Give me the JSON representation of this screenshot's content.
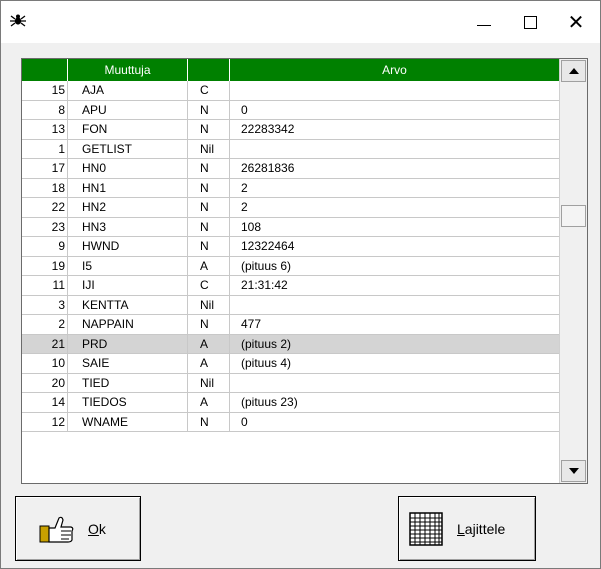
{
  "window": {
    "app_icon": "spider-icon",
    "controls": {
      "minimize": "minimize-icon",
      "maximize": "maximize-icon",
      "close": "close-icon"
    }
  },
  "grid": {
    "columns": [
      "",
      "Muuttuja",
      "",
      "Arvo"
    ],
    "header_color": "#008000",
    "selected_row_color": "#d4d4d4",
    "rows": [
      {
        "num": "15",
        "name": "AJA",
        "type": "C",
        "value": ""
      },
      {
        "num": "8",
        "name": "APU",
        "type": "N",
        "value": "0"
      },
      {
        "num": "13",
        "name": "FON",
        "type": "N",
        "value": "22283342"
      },
      {
        "num": "1",
        "name": "GETLIST",
        "type": "Nil",
        "value": ""
      },
      {
        "num": "17",
        "name": "HN0",
        "type": "N",
        "value": "26281836"
      },
      {
        "num": "18",
        "name": "HN1",
        "type": "N",
        "value": "2"
      },
      {
        "num": "22",
        "name": "HN2",
        "type": "N",
        "value": "2"
      },
      {
        "num": "23",
        "name": "HN3",
        "type": "N",
        "value": "108"
      },
      {
        "num": "9",
        "name": "HWND",
        "type": "N",
        "value": "12322464"
      },
      {
        "num": "19",
        "name": "I5",
        "type": "A",
        "value": "(pituus 6)"
      },
      {
        "num": "11",
        "name": "IJI",
        "type": "C",
        "value": "21:31:42"
      },
      {
        "num": "3",
        "name": "KENTTA",
        "type": "Nil",
        "value": ""
      },
      {
        "num": "2",
        "name": "NAPPAIN",
        "type": "N",
        "value": "477"
      },
      {
        "num": "21",
        "name": "PRD",
        "type": "A",
        "value": "(pituus 2)"
      },
      {
        "num": "10",
        "name": "SAIE",
        "type": "A",
        "value": "(pituus 4)"
      },
      {
        "num": "20",
        "name": "TIED",
        "type": "Nil",
        "value": ""
      },
      {
        "num": "14",
        "name": "TIEDOS",
        "type": "A",
        "value": "(pituus 23)"
      },
      {
        "num": "12",
        "name": "WNAME",
        "type": "N",
        "value": "0"
      }
    ],
    "selected_index": 13
  },
  "buttons": {
    "ok": {
      "label_u": "O",
      "label_rest": "k",
      "icon": "thumbs-up-hand-icon"
    },
    "sort": {
      "label_u": "L",
      "label_rest": "ajittele",
      "icon": "grid-table-icon"
    }
  }
}
